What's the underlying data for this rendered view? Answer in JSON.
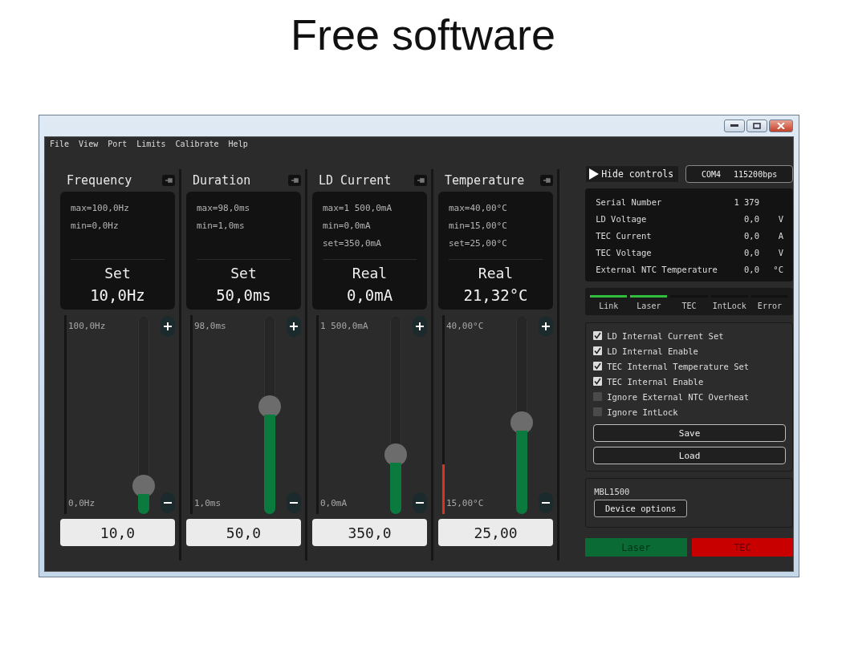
{
  "slide_title": "Free software",
  "menu": [
    "File",
    "View",
    "Port",
    "Limits",
    "Calibrate",
    "Help"
  ],
  "channels": [
    {
      "title": "Frequency",
      "info": [
        "max=100,0Hz",
        "min=0,0Hz"
      ],
      "mode": "Set",
      "reading": "10,0Hz",
      "top_label": "100,0Hz",
      "bottom_label": "0,0Hz",
      "level": 0.1,
      "indicator": {
        "level": 0
      },
      "value": "10,0"
    },
    {
      "title": "Duration",
      "info": [
        "max=98,0ms",
        "min=1,0ms"
      ],
      "mode": "Set",
      "reading": "50,0ms",
      "top_label": "98,0ms",
      "bottom_label": "1,0ms",
      "level": 0.5,
      "indicator": {
        "level": 0
      },
      "value": "50,0"
    },
    {
      "title": "LD Current",
      "info": [
        "max=1 500,0mA",
        "min=0,0mA",
        "set=350,0mA"
      ],
      "mode": "Real",
      "reading": "0,0mA",
      "top_label": "1 500,0mA",
      "bottom_label": "0,0mA",
      "level": 0.26,
      "indicator": {
        "level": 0
      },
      "value": "350,0"
    },
    {
      "title": "Temperature",
      "info": [
        "max=40,00°C",
        "min=15,00°C",
        "set=25,00°C"
      ],
      "mode": "Real",
      "reading": "21,32°C",
      "top_label": "40,00°C",
      "bottom_label": "15,00°C",
      "level": 0.42,
      "indicator": {
        "level": 0.25
      },
      "value": "25,00"
    }
  ],
  "hide_controls": "Hide controls",
  "port": {
    "name": "COM4",
    "speed": "115200bps"
  },
  "readings": [
    {
      "label": "Serial Number",
      "value": "1 379"
    },
    {
      "label": "LD Voltage",
      "value": "0,0",
      "unit": "V"
    },
    {
      "label": "TEC Current",
      "value": "0,0",
      "unit": "A"
    },
    {
      "label": "TEC Voltage",
      "value": "0,0",
      "unit": "V"
    },
    {
      "label": "External NTC Temperature",
      "value": "0,0",
      "unit": "°C"
    }
  ],
  "indicators": [
    {
      "label": "Link",
      "on": true
    },
    {
      "label": "Laser",
      "on": true
    },
    {
      "label": "TEC",
      "on": false
    },
    {
      "label": "IntLock",
      "on": false
    },
    {
      "label": "Error",
      "on": false
    }
  ],
  "options": [
    {
      "label": "LD Internal Current Set",
      "checked": true
    },
    {
      "label": "LD Internal Enable",
      "checked": true
    },
    {
      "label": "TEC Internal Temperature Set",
      "checked": true
    },
    {
      "label": "TEC Internal Enable",
      "checked": true
    },
    {
      "label": "Ignore External NTC Overheat",
      "checked": false
    },
    {
      "label": "Ignore IntLock",
      "checked": false
    }
  ],
  "option_buttons": [
    "Save",
    "Load"
  ],
  "device": {
    "model": "MBL1500",
    "button": "Device options"
  },
  "state_buttons": [
    {
      "label": "Laser",
      "color": "#0b6b35"
    },
    {
      "label": "TEC",
      "color": "#c80000"
    }
  ]
}
